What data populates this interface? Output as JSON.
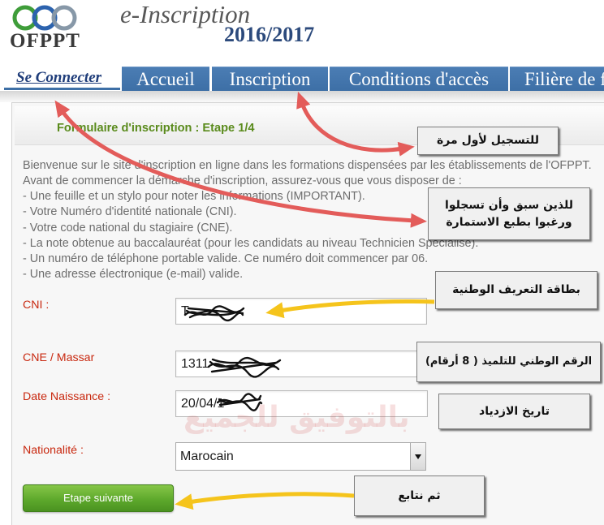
{
  "header": {
    "logo_text": "OFPPT",
    "app_title": "e-Inscription",
    "year": "2016/2017"
  },
  "nav": {
    "login_link": "Se Connecter",
    "tabs": [
      {
        "label": "Accueil"
      },
      {
        "label": "Inscription"
      },
      {
        "label": "Conditions d'accès"
      },
      {
        "label": "Filière de f"
      }
    ]
  },
  "form": {
    "title": "Formulaire d'inscription : Etape 1/4",
    "intro": [
      "Bienvenue sur le site d'inscription en ligne dans les formations dispensées par les établissements de l'OFPPT.",
      "Avant de commencer la démarche d'inscription, assurez-vous que vous disposer de :",
      "- Une feuille et un stylo pour noter les informations (IMPORTANT).",
      "- Votre Numéro d'identité nationale (CNI).",
      "- Votre code national du stagiaire (CNE).",
      "- La note obtenue au baccalauréat (pour les candidats au niveau Technicien Spécialisé).",
      "- Un numéro de téléphone portable valide. Ce numéro doit commencer par 06.",
      "- Une adresse électronique (e-mail) valide."
    ],
    "fields": {
      "cni": {
        "label": "CNI :",
        "value": "T"
      },
      "cne": {
        "label": "CNE / Massar",
        "value": "1311"
      },
      "birth_date": {
        "label": "Date Naissance :",
        "value": "20/04/1"
      },
      "nationality": {
        "label": "Nationalité :",
        "value": "Marocain"
      }
    },
    "next_button": "Etape suivante"
  },
  "annotations": {
    "first_registration": "للتسجيل لأول مرة",
    "already_registered": [
      "للذين سبق وأن تسجلوا",
      "ورغبوا بطبع الاستمارة"
    ],
    "national_id_card": "بطاقة التعريف الوطنية",
    "student_number": "الرقم الوطني للتلميذ ( 8 أرقام)",
    "birth_date": "تاريخ الازدياد",
    "then_continue": "ثم نتابع"
  },
  "watermark": "بالتوفيق للجميع",
  "colors": {
    "nav_tab": "#3d6fa6",
    "form_title": "#5a8b1c",
    "field_label": "#c8280f",
    "button": "#5ea92c",
    "arrow_red": "#e35c5a",
    "arrow_yellow": "#f5c41c",
    "logo_rings": [
      "#3f9d3a",
      "#2c63ae",
      "#8798a8"
    ]
  }
}
